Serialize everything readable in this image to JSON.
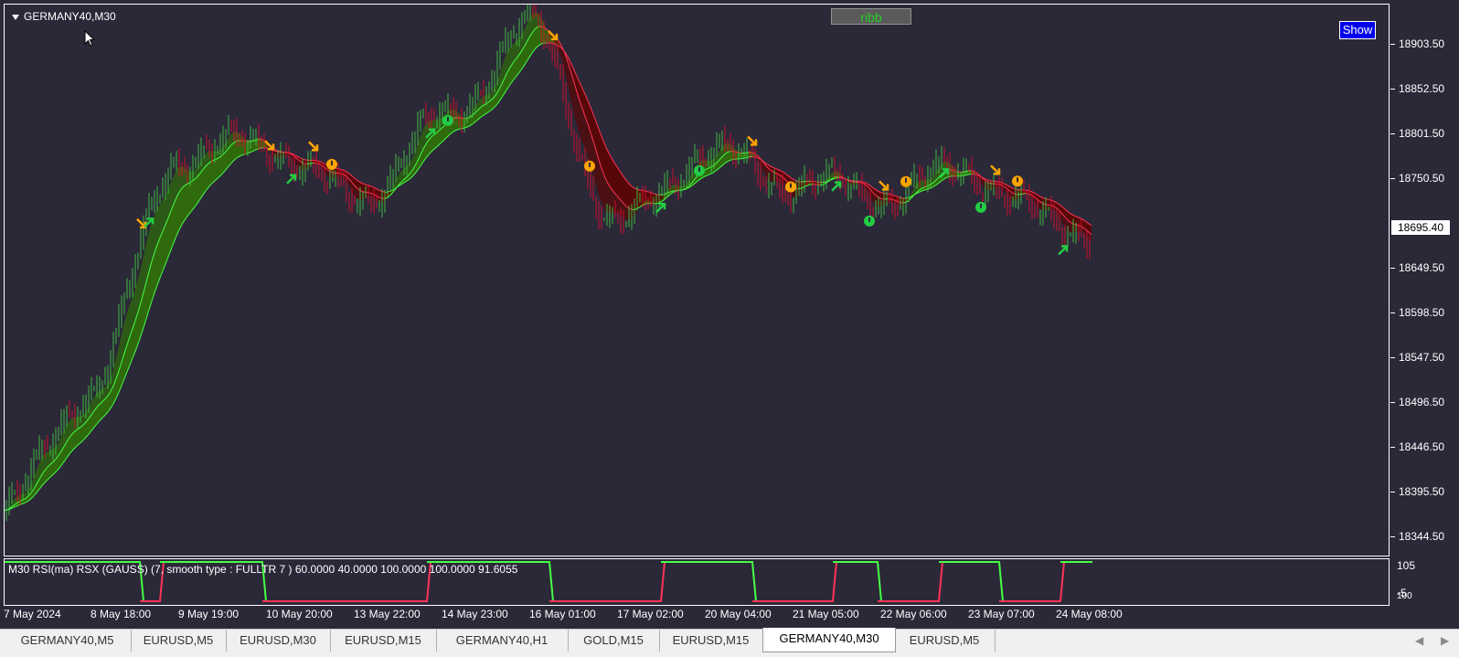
{
  "window": {
    "symbol_title": "GERMANY40,M30",
    "ribbon_button": "ribb",
    "show_button": "Show"
  },
  "indicator": {
    "label": "M30 RSI(ma) RSX (GAUSS) (7, smooth type : FULLTR  7 ) 60.0000 40.0000 100.0000 100.0000 91.6055",
    "levels": [
      "105",
      "-5"
    ],
    "extra_level": "100"
  },
  "price_axis": {
    "labels": [
      "18903.50",
      "18852.50",
      "18801.50",
      "18750.50",
      "18649.50",
      "18598.50",
      "18547.50",
      "18496.50",
      "18446.50",
      "18395.50",
      "18344.50"
    ],
    "current_price": "18695.40"
  },
  "time_axis": {
    "labels": [
      "7 May 2024",
      "8 May 18:00",
      "9 May 19:00",
      "10 May 20:00",
      "13 May 22:00",
      "14 May 23:00",
      "16 May 01:00",
      "17 May 02:00",
      "20 May 04:00",
      "21 May 05:00",
      "22 May 06:00",
      "23 May 07:00",
      "24 May 08:00"
    ]
  },
  "tabs": [
    {
      "label": "GERMANY40,M5",
      "active": false
    },
    {
      "label": "EURUSD,M5",
      "active": false
    },
    {
      "label": "EURUSD,M30",
      "active": false
    },
    {
      "label": "EURUSD,M15",
      "active": false
    },
    {
      "label": "GERMANY40,H1",
      "active": false
    },
    {
      "label": "GOLD,M15",
      "active": false
    },
    {
      "label": "EURUSD,M15",
      "active": false
    },
    {
      "label": "GERMANY40,M30",
      "active": true
    },
    {
      "label": "EURUSD,M5",
      "active": false
    }
  ],
  "colors": {
    "background": "#2b2838",
    "bull_fill": "#2f6e0a",
    "bear_fill": "#5a0505",
    "bull_line": "#44ff44",
    "bear_line": "#ff3355",
    "up_arrow": "#22cc44",
    "down_arrow": "#ffa500"
  },
  "chart_data": {
    "type": "line",
    "symbol": "GERMANY40",
    "timeframe": "M30",
    "x": [
      "7 May 2024",
      "8 May 18:00",
      "9 May 19:00",
      "10 May 20:00",
      "13 May 22:00",
      "14 May 23:00",
      "16 May 01:00",
      "17 May 02:00",
      "20 May 04:00",
      "21 May 05:00",
      "22 May 06:00",
      "23 May 07:00",
      "24 May 08:00"
    ],
    "ylim": [
      18320,
      18930
    ],
    "series": [
      {
        "values": [
          18370,
          18500,
          18760,
          18780,
          18720,
          18800,
          18900,
          18680,
          18770,
          18740,
          18720,
          18740,
          18680
        ]
      }
    ]
  }
}
